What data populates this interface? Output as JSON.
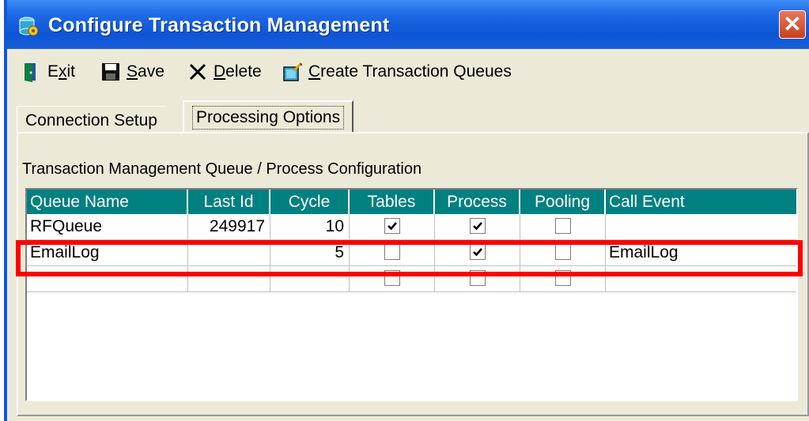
{
  "window": {
    "title": "Configure Transaction Management",
    "close_glyph": "✕"
  },
  "toolbar": {
    "exit": {
      "accel": "x",
      "pre": "E",
      "post": "it",
      "icon": "exit-door-icon"
    },
    "save": {
      "accel": "S",
      "pre": "",
      "post": "ave",
      "icon": "floppy-disk-icon"
    },
    "delete": {
      "accel": "D",
      "pre": "",
      "post": "elete",
      "icon": "delete-x-icon"
    },
    "create": {
      "accel": "C",
      "pre": "",
      "post": "reate Transaction Queues",
      "icon": "create-queue-icon"
    }
  },
  "tabs": [
    {
      "label": "Connection Setup",
      "active": false
    },
    {
      "label": "Processing Options",
      "active": true
    }
  ],
  "section_label": "Transaction Management Queue / Process Configuration",
  "grid": {
    "columns": [
      "Queue Name",
      "Last Id",
      "Cycle",
      "Tables",
      "Process",
      "Pooling",
      "Call Event"
    ],
    "rows": [
      {
        "queue_name": "RFQueue",
        "last_id": "249917",
        "cycle": "10",
        "tables": true,
        "process": true,
        "pooling": false,
        "call_event": ""
      },
      {
        "queue_name": "EmailLog",
        "last_id": "",
        "cycle": "5",
        "tables": false,
        "process": true,
        "pooling": false,
        "call_event": "EmailLog"
      },
      {
        "queue_name": "",
        "last_id": "",
        "cycle": "",
        "tables": false,
        "process": false,
        "pooling": false,
        "call_event": ""
      }
    ]
  },
  "colors": {
    "header_bg": "#008080",
    "highlight": "#ff0000",
    "title_bar": "#0c55d6"
  }
}
